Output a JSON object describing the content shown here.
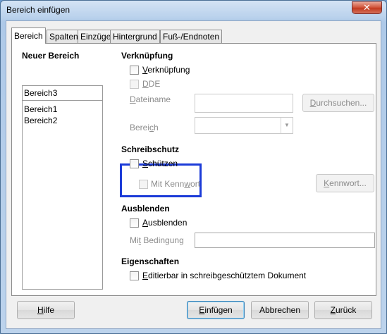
{
  "window": {
    "title": "Bereich einfügen",
    "close_glyph": "✕"
  },
  "tabs": [
    {
      "label": "Bereich",
      "active": true
    },
    {
      "label": "Spalten",
      "active": false
    },
    {
      "label": "Einzüge",
      "active": false
    },
    {
      "label": "Hintergrund",
      "active": false
    },
    {
      "label": "Fuß-/Endnoten",
      "active": false
    }
  ],
  "new_section": {
    "heading": "Neuer Bereich",
    "name_value": "Bereich3",
    "list_items": [
      "Bereich1",
      "Bereich2"
    ]
  },
  "link": {
    "heading": "Verknüpfung",
    "link_checkbox": {
      "pre": "",
      "key": "V",
      "post": "erknüpfung",
      "checked": false
    },
    "dde_checkbox": {
      "pre": "",
      "key": "D",
      "post": "DE",
      "checked": false,
      "disabled": true
    },
    "filename": {
      "pre": "",
      "key": "D",
      "post": "ateiname"
    },
    "browse_button": {
      "pre": "",
      "key": "D",
      "post": "urchsuchen..."
    },
    "section": {
      "pre": "Berei",
      "key": "c",
      "post": "h"
    }
  },
  "write_protection": {
    "heading": "Schreibschutz",
    "protect_checkbox": {
      "pre": "",
      "key": "S",
      "post": "chützen",
      "checked": false
    },
    "password_checkbox": {
      "pre": "Mit Kenn",
      "key": "w",
      "post": "ort",
      "checked": false,
      "disabled": true
    },
    "password_button": {
      "pre": "",
      "key": "K",
      "post": "ennwort..."
    }
  },
  "hide": {
    "heading": "Ausblenden",
    "hide_checkbox": {
      "pre": "",
      "key": "A",
      "post": "usblenden",
      "checked": false
    },
    "condition": {
      "pre": "Mi",
      "key": "t",
      "post": " Bedingung",
      "value": ""
    }
  },
  "properties": {
    "heading": "Eigenschaften",
    "editable_checkbox": {
      "pre": "",
      "key": "E",
      "post": "ditierbar in schreibgeschütztem Dokument",
      "checked": false
    }
  },
  "buttons": {
    "help": {
      "pre": "",
      "key": "H",
      "post": "ilfe"
    },
    "insert": {
      "pre": "",
      "key": "E",
      "post": "infügen"
    },
    "cancel": {
      "label": "Abbrechen"
    },
    "back": {
      "pre": "",
      "key": "Z",
      "post": "urück"
    }
  },
  "colors": {
    "highlight_border": "#1c3bd8",
    "default_button_border": "#3c7fb1"
  }
}
